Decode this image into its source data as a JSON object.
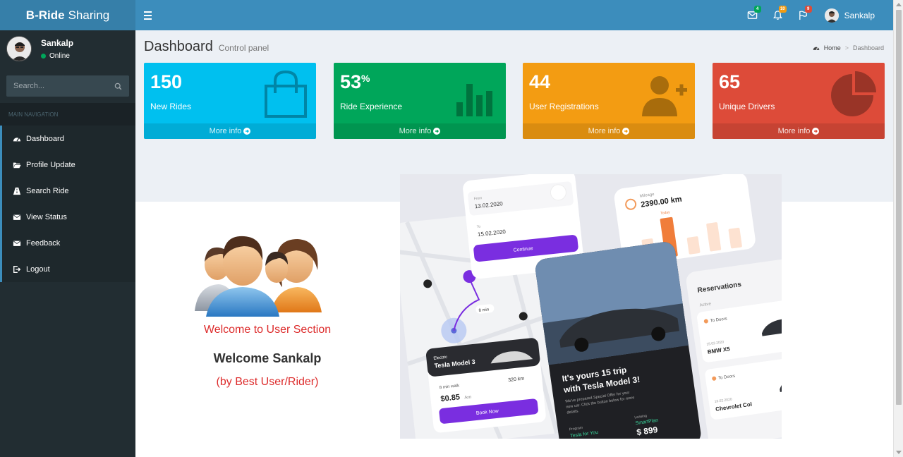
{
  "brand": {
    "bold": "B-Ride",
    "rest": "Sharing"
  },
  "header": {
    "mail_count": "4",
    "notification_count": "10",
    "flag_count": "9",
    "user_name": "Sankalp",
    "badge_colors": {
      "mail": "#00a65a",
      "notification": "#f39c12",
      "flag": "#dd4b39"
    }
  },
  "sidebar": {
    "user_name": "Sankalp",
    "status": "Online",
    "search_placeholder": "Search...",
    "nav_header": "MAIN NAVIGATION",
    "items": [
      {
        "label": "Dashboard",
        "icon": "dashboard-icon"
      },
      {
        "label": "Profile Update",
        "icon": "folder-open-icon"
      },
      {
        "label": "Search Ride",
        "icon": "road-icon"
      },
      {
        "label": "View Status",
        "icon": "envelope-icon"
      },
      {
        "label": "Feedback",
        "icon": "envelope-icon"
      },
      {
        "label": "Logout",
        "icon": "sign-out-icon"
      }
    ]
  },
  "content_header": {
    "title": "Dashboard",
    "subtitle": "Control panel",
    "breadcrumb_home": "Home",
    "breadcrumb_current": "Dashboard"
  },
  "stats": [
    {
      "value": "150",
      "suffix": "",
      "label": "New Rides",
      "footer": "More info",
      "color": "#00c0ef",
      "icon": "shopping-bag-icon"
    },
    {
      "value": "53",
      "suffix": "%",
      "label": "Ride Experience",
      "footer": "More info",
      "color": "#00a65a",
      "icon": "bar-chart-icon"
    },
    {
      "value": "44",
      "suffix": "",
      "label": "User Registrations",
      "footer": "More info",
      "color": "#f39c12",
      "icon": "user-plus-icon"
    },
    {
      "value": "65",
      "suffix": "",
      "label": "Unique Drivers",
      "footer": "More info",
      "color": "#dd4b39",
      "icon": "pie-chart-icon"
    }
  ],
  "welcome": {
    "section": "Welcome to User Section",
    "name": "Welcome Sankalp",
    "by": "(by Best User/Rider)"
  },
  "app_mockup": {
    "from_label": "From",
    "from_date": "13.02.2020",
    "to_label": "To",
    "to_date": "15.02.2020",
    "continue": "Continue",
    "mileage_label": "Mileage",
    "mileage": "2390.00 km",
    "today": "Today",
    "route_time": "8 min",
    "car_type": "Electric",
    "car_name": "Tesla Model 3",
    "walk": "8 min walk",
    "range": "320 km",
    "price": "$0.85",
    "price_unit": "/km",
    "book": "Book Now",
    "promo_title_1": "It's yours 15 trip",
    "promo_title_2": "with Tesla Model 3!",
    "promo_text_1": "We've prepared Special Offer for your",
    "promo_text_2": "new car. Click the button below for more",
    "promo_text_3": "details.",
    "program_label": "Program",
    "program": "Tesla for You",
    "leasing_label": "Leasing",
    "leasing": "SmartPlan",
    "leasing_price": "$ 899",
    "big_num": "1029",
    "reservations": "Reservations",
    "active": "Active",
    "res1_place": "To Doors",
    "res1_date": "15.02.2020",
    "res1_car": "BMW X5",
    "res2_place": "To Doors",
    "res2_date": "16.02.2020",
    "res2_car": "Chevrolet Col"
  }
}
